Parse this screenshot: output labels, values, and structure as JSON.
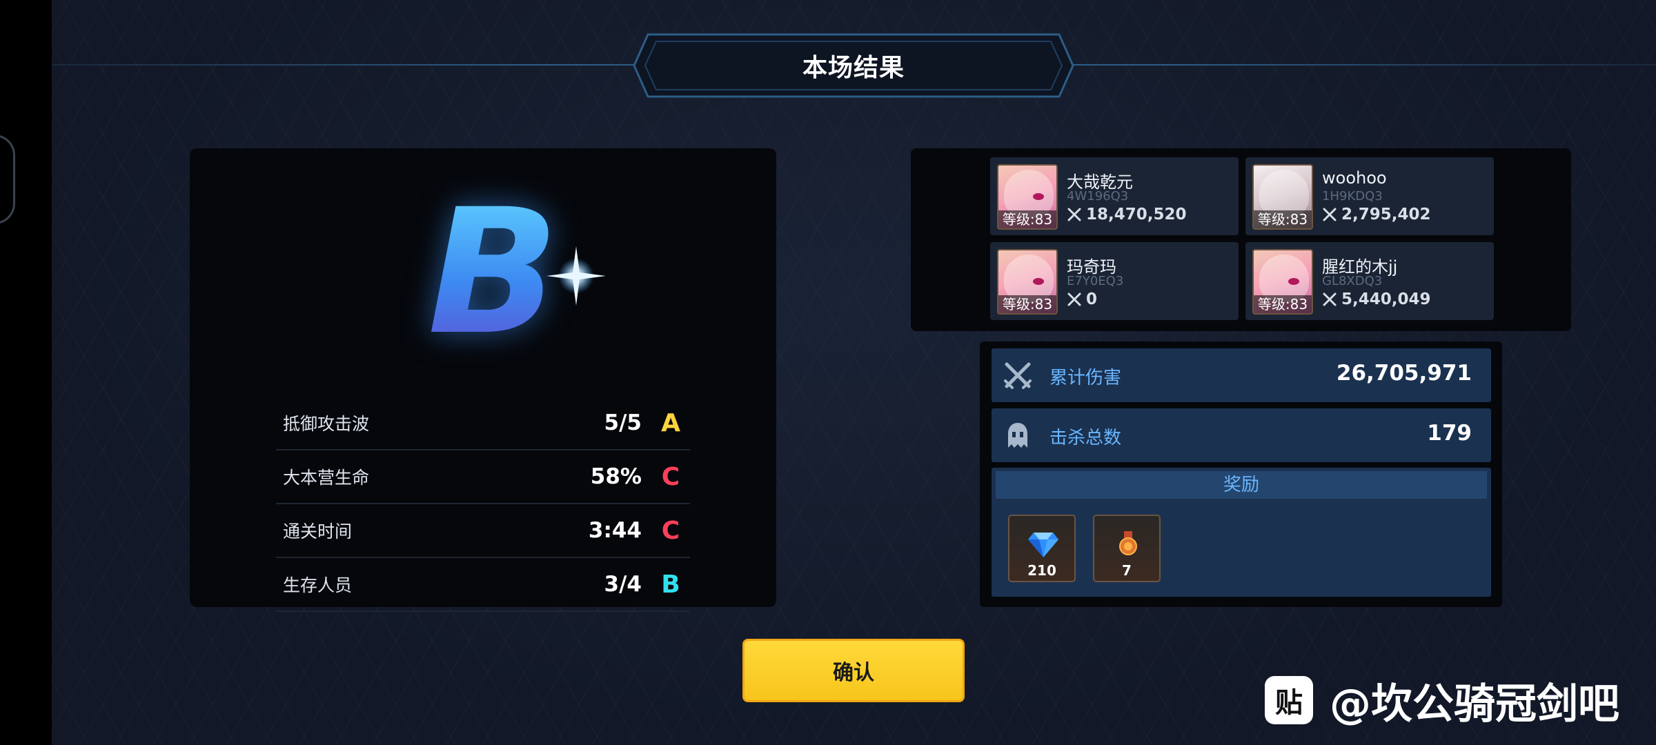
{
  "header": {
    "title": "本场结果"
  },
  "result": {
    "grade": "B",
    "stats": [
      {
        "label": "抵御攻击波",
        "value": "5/5",
        "grade": "A",
        "grade_color": "#ffd43b"
      },
      {
        "label": "大本营生命",
        "value": "58%",
        "grade": "C",
        "grade_color": "#ff3f5b"
      },
      {
        "label": "通关时间",
        "value": "3:44",
        "grade": "C",
        "grade_color": "#ff3f5b"
      },
      {
        "label": "生存人员",
        "value": "3/4",
        "grade": "B",
        "grade_color": "#31e0ee"
      }
    ]
  },
  "players": [
    {
      "name": "大哉乾元",
      "id": "4W196Q3",
      "level": "等级:83",
      "damage": "18,470,520",
      "avatar": "pink-hair-avatar"
    },
    {
      "name": "woohoo",
      "id": "1H9KDQ3",
      "level": "等级:83",
      "damage": "2,795,402",
      "avatar": "silver-hair-avatar"
    },
    {
      "name": "玛奇玛",
      "id": "E7Y0EQ3",
      "level": "等级:83",
      "damage": "0",
      "avatar": "pink-hair-avatar"
    },
    {
      "name": "腥红的木jj",
      "id": "GL8XDQ3",
      "level": "等级:83",
      "damage": "5,440,049",
      "avatar": "pink-hair-avatar"
    }
  ],
  "summary": {
    "damage_label": "累计伤害",
    "damage_value": "26,705,971",
    "kills_label": "击杀总数",
    "kills_value": "179"
  },
  "rewards": {
    "header": "奖励",
    "items": [
      {
        "icon": "gem-icon",
        "count": "210"
      },
      {
        "icon": "medal-icon",
        "count": "7"
      }
    ]
  },
  "confirm_label": "确认",
  "watermark": {
    "logo": "贴",
    "text": "@坎公骑冠剑吧"
  }
}
